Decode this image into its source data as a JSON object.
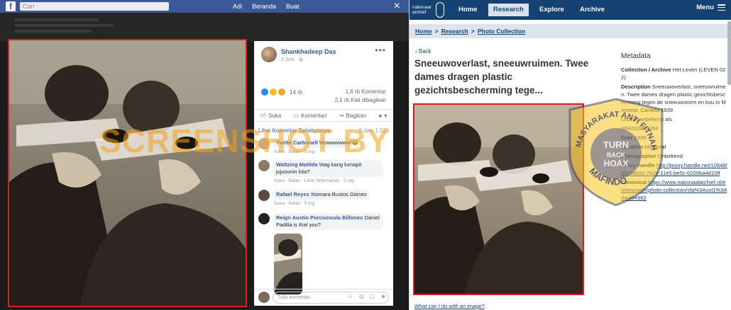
{
  "facebook": {
    "search_placeholder": "Cari",
    "nav": [
      "Adi",
      "Beranda",
      "Buat"
    ],
    "close_icon": "×",
    "post": {
      "author": "Shankhadeep Das",
      "date": "3 Juni · ",
      "reaction_count": "14 rb",
      "comment_count": "1,6 rb Komentar",
      "share_count": "2,1 rb Kali dibagikan",
      "actions": {
        "like": "Suka",
        "comment": "Komentari",
        "share": "Bagikan"
      }
    },
    "comments_header": {
      "previous": "Lihat Komentar Sebelumnya",
      "count": "6 dari 1.325"
    },
    "comments": [
      {
        "name": "Yvette Carbonell",
        "text": "Wowwwwww!😂",
        "meta": "Suka · Balas · 5 mg"
      },
      {
        "name": "Waltzing Matilda",
        "text": "Wag kang lumapit jujusunin kita?",
        "meta": "Suka · Balas · Lihat Terjemahan · 5 mg"
      },
      {
        "name": "Rafael Reyes",
        "text": "Xiomara Bustos Gómez",
        "meta": "Suka · Balas · 5 mg"
      },
      {
        "name": "Reign Austin Porciuncula Billones",
        "text": "Daniel Padilla is that you?",
        "meta": ""
      }
    ],
    "comment_placeholder": "Tulis komentar...",
    "comment_input_icons": "☺ ◎ ▢ ◈"
  },
  "archief": {
    "logo": {
      "line1": "nationaal",
      "line2": "archief"
    },
    "nav": {
      "home": "Home",
      "research": "Research",
      "explore": "Explore",
      "archive": "Archive",
      "menu": "Menu"
    },
    "breadcrumb": {
      "home": "Home",
      "research": "Research",
      "photo_collection": "Photo Collection",
      "separator": ">"
    },
    "back": "Back",
    "title": "Sneeuwoverlast, sneeuwruimen. Twee dames dragen plastic gezichtsbescherming tege...",
    "what_link": "What can I do with an image?",
    "metadata": {
      "heading": "Metadata",
      "collection_label": "Collection / Archive",
      "collection_value": "Het Leven (LEVEN 022)",
      "description_label": "Description",
      "description_value": "Sneeuwoverlast, sneeuwruimen. Twee dames dragen plastic gezichtsbescherming tegen de sneeuwstorm en kou in Montreal, Canada 1939",
      "photographer_hidden": "Locatie onbekend",
      "ref_label": "als",
      "ref_value": "SFA022803354",
      "date_label": "Date",
      "date_value": "1939",
      "location_label": "Location",
      "location_value": "Montreal",
      "photographer_label": "Photographer",
      "photographer_value": "Onbekend",
      "proxy_label": "Proxy handle",
      "proxy_value": "http://proxy.handle.net/10648/5528ab5c-7e29-11e5-be5c-0200ba4d15ff",
      "canonical_label": "Canonical",
      "canonical_value": "https://www.nationaalarchief.nl/en/research/photo-collection/sfa%3Acol1%3Adat494962"
    }
  },
  "watermark": {
    "text": "SCREENSHOT BY",
    "badge_top": "MASYARAKAT ANTI FITNAH",
    "badge_center_line1": "TURN",
    "badge_center_line2": "BACK",
    "badge_center_line3": "HOAX",
    "badge_bottom": "MAFINDO"
  },
  "colors": {
    "facebook_blue": "#3b5998",
    "archief_blue": "#154273",
    "highlight_red": "#e01b1b",
    "watermark_orange": "#f2a314"
  }
}
